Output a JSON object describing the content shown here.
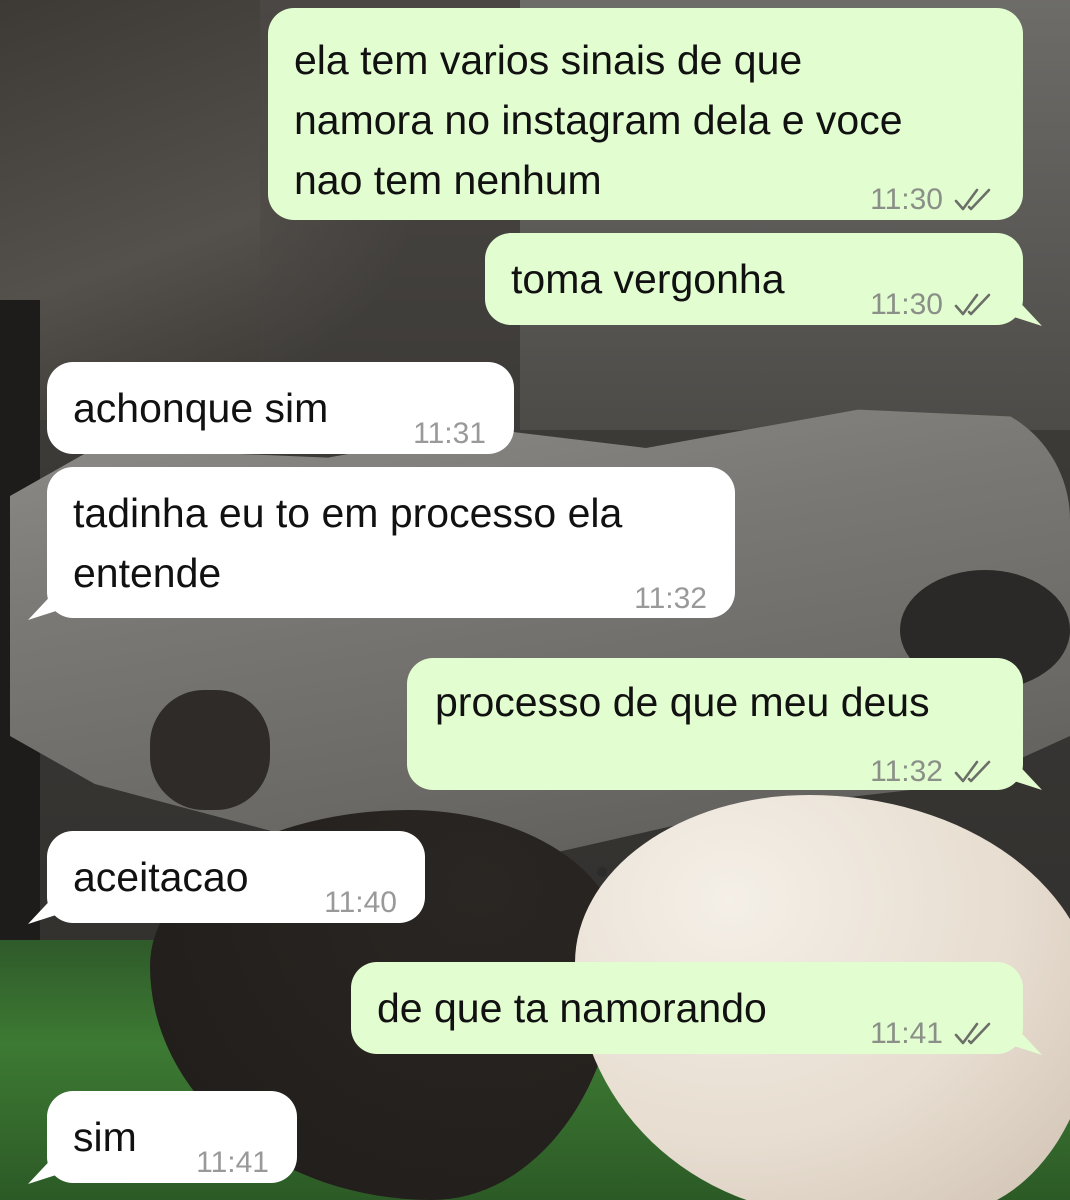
{
  "messages": [
    {
      "direction": "out",
      "text_lines": [
        "ela tem varios sinais de que",
        "namora no instagram dela e voce",
        "nao tem nenhum"
      ],
      "time": "11:30",
      "status": "read-check-icon"
    },
    {
      "direction": "out",
      "text_lines": [
        "toma vergonha"
      ],
      "time": "11:30",
      "status": "read-check-icon"
    },
    {
      "direction": "in",
      "text_lines": [
        "achonque sim"
      ],
      "time": "11:31"
    },
    {
      "direction": "in",
      "text_lines": [
        "tadinha eu to em processo ela",
        "entende"
      ],
      "time": "11:32"
    },
    {
      "direction": "out",
      "text_lines": [
        "processo de que meu deus"
      ],
      "time": "11:32",
      "status": "read-check-icon"
    },
    {
      "direction": "in",
      "text_lines": [
        "aceitacao"
      ],
      "time": "11:40"
    },
    {
      "direction": "out",
      "text_lines": [
        "de que ta namorando"
      ],
      "time": "11:41",
      "status": "read-check-icon"
    },
    {
      "direction": "in",
      "text_lines": [
        "sim"
      ],
      "time": "11:41"
    }
  ],
  "colors": {
    "outgoing_bubble": "#e2fdd0",
    "incoming_bubble": "#ffffff",
    "timestamp": "#8a8f87"
  }
}
